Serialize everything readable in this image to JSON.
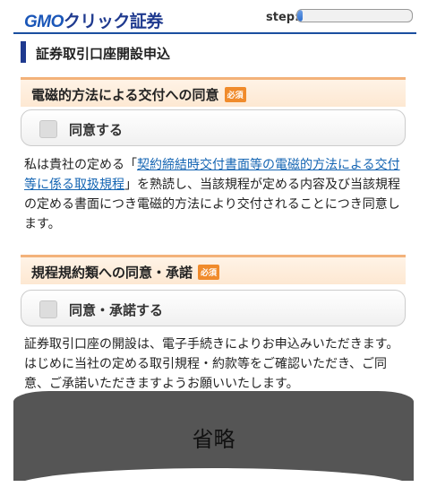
{
  "header": {
    "logo_gmo": "GMO",
    "logo_rest": "クリック証券",
    "step_label": "step:",
    "step_progress": 0.05
  },
  "page_title": "証券取引口座開設申込",
  "sections": [
    {
      "title": "電磁的方法による交付への同意",
      "badge": "必須",
      "agree_label": "同意する",
      "text_before": "私は貴社の定める「",
      "link_text": "契約締結時交付書面等の電磁的方法による交付等に係る取扱規程",
      "text_after": "」を熟読し、当該規程が定める内容及び当該規程の定める書面につき電磁的方法により交付されることにつき同意します。"
    },
    {
      "title": "規程規約類への同意・承諾",
      "badge": "必須",
      "agree_label": "同意・承諾する",
      "text": "証券取引口座の開設は、電子手続きによりお申込みいただきます。はじめに当社の定める取引規程・約款等をご確認いただき、ご同意、ご承諾いただきますようお願いいたします。"
    }
  ],
  "overlay_label": "省略"
}
